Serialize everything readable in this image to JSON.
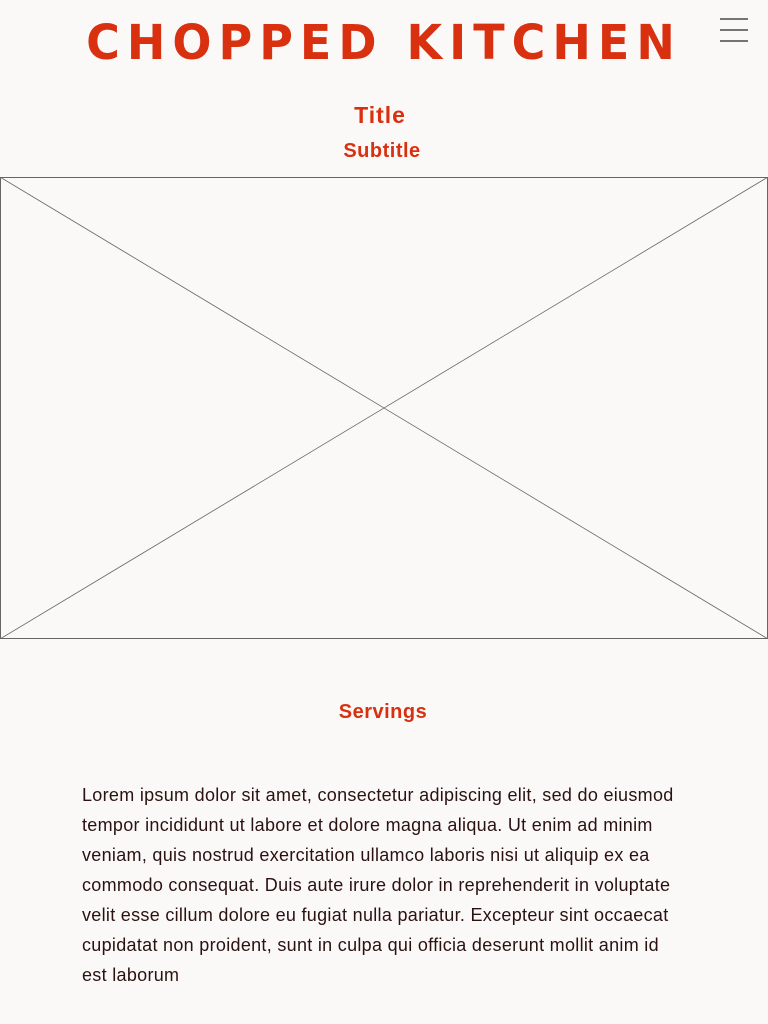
{
  "header": {
    "brand": "CHOPPED KITCHEN",
    "menu_icon": "hamburger-menu-icon"
  },
  "recipe": {
    "title": "Title",
    "subtitle": "Subtitle",
    "image_icon": "image-placeholder-icon",
    "servings_label": "Servings",
    "description": "Lorem ipsum dolor sit amet, consectetur adipiscing elit, sed do eiusmod tempor incididunt ut labore et dolore magna aliqua. Ut enim ad minim veniam, quis nostrud exercitation ullamco laboris nisi ut aliquip ex ea commodo consequat. Duis aute irure dolor in reprehenderit in voluptate velit esse cillum dolore eu fugiat nulla pariatur. Excepteur sint occaecat cupidatat non proident, sunt in culpa qui officia deserunt mollit anim id est laborum"
  },
  "colors": {
    "accent": "#d9300f",
    "background": "#fbf9f8",
    "body_text": "#2a1210",
    "menu_icon": "#757575",
    "placeholder_stroke": "#666666"
  }
}
